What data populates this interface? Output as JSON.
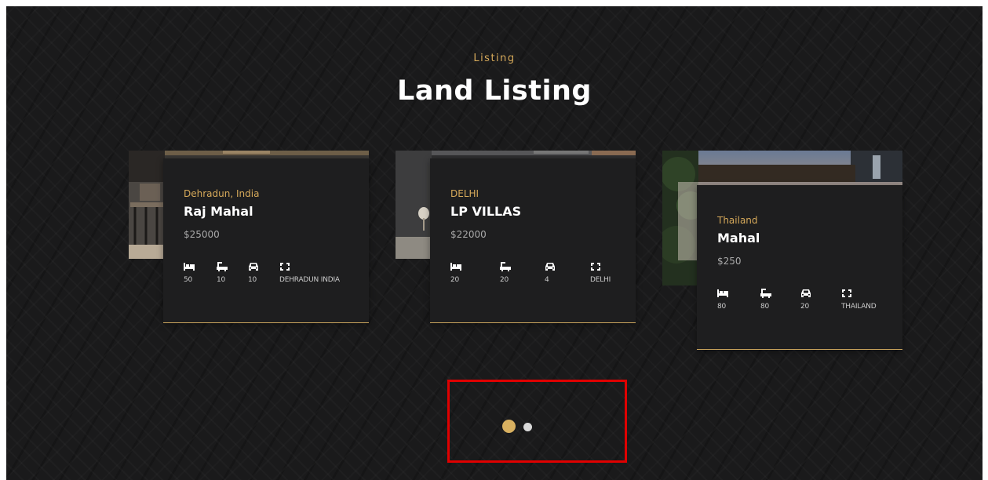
{
  "section": {
    "eyebrow": "Listing",
    "title": "Land Listing"
  },
  "listings": [
    {
      "location": "Dehradun, India",
      "name": "Raj Mahal",
      "price": "$25000",
      "features": [
        {
          "icon": "bed-icon",
          "value": "50"
        },
        {
          "icon": "bath-icon",
          "value": "10"
        },
        {
          "icon": "car-icon",
          "value": "10"
        },
        {
          "icon": "area-icon",
          "value": "DEHRADUN INDIA"
        }
      ]
    },
    {
      "location": "DELHI",
      "name": "LP VILLAS",
      "price": "$22000",
      "features": [
        {
          "icon": "bed-icon",
          "value": "20"
        },
        {
          "icon": "bath-icon",
          "value": "20"
        },
        {
          "icon": "car-icon",
          "value": "4"
        },
        {
          "icon": "area-icon",
          "value": "DELHI"
        }
      ]
    },
    {
      "location": "Thailand",
      "name": "Mahal",
      "price": "$250",
      "features": [
        {
          "icon": "bed-icon",
          "value": "80"
        },
        {
          "icon": "bath-icon",
          "value": "80"
        },
        {
          "icon": "car-icon",
          "value": "20"
        },
        {
          "icon": "area-icon",
          "value": "THAILAND"
        }
      ]
    }
  ],
  "pagination": {
    "pages": 2,
    "active_page": 1,
    "active_color": "#d8b060",
    "inactive_color": "#d9d9d9"
  },
  "colors": {
    "background": "#1a1a1b",
    "accent": "#d6a95a",
    "card": "#1e1e1f",
    "highlight_box": "#e00000"
  }
}
